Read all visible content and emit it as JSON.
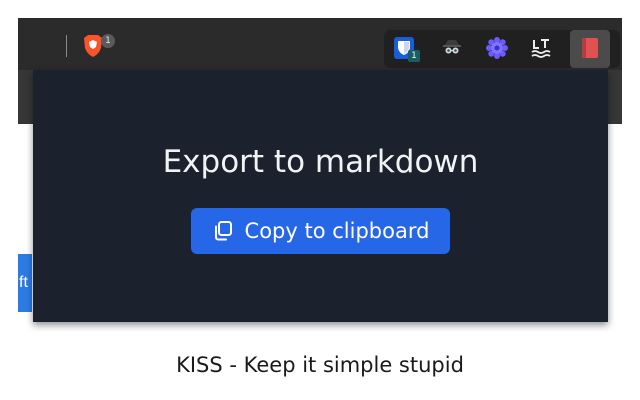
{
  "toolbar": {
    "brave_shield_icon": "brave-lion-icon",
    "brave_badge": "1",
    "extensions": [
      {
        "icon": "bitwarden-shield-icon",
        "badge": "1"
      },
      {
        "icon": "incognito-spy-icon"
      },
      {
        "icon": "blue-gear-flower-icon"
      },
      {
        "icon": "languagetool-icon"
      },
      {
        "icon": "red-notebook-icon"
      }
    ]
  },
  "page": {
    "button_fragment": "ft"
  },
  "popup": {
    "title": "Export to markdown",
    "copy_button_label": "Copy to clipboard",
    "copy_icon": "copy-icon"
  },
  "caption": "KISS - Keep it simple stupid",
  "colors": {
    "popup_background": "#1b222d",
    "button_blue": "#2667e8",
    "toolbar_dark": "#2b2b2b"
  }
}
